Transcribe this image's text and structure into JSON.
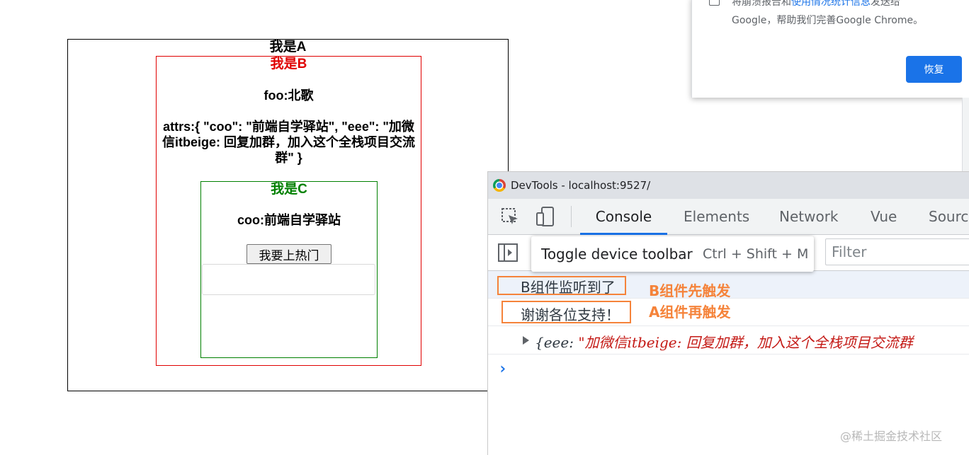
{
  "components": {
    "a": {
      "title": "我是A"
    },
    "b": {
      "title": "我是B",
      "foo": "foo:北歌",
      "attrs": "attrs:{ \"coo\": \"前端自学驿站\", \"eee\": \"加微信itbeige: 回复加群，加入这个全栈项目交流群\" }"
    },
    "c": {
      "title": "我是C",
      "coo": "coo:前端自学驿站",
      "button_label": "我要上热门",
      "input_value": ""
    }
  },
  "popup": {
    "line1_prefix": "将崩溃报告和",
    "line1_link": "使用情况统计信息",
    "line1_suffix": "发送给",
    "line2": "Google，帮助我们完善Google Chrome。",
    "button_label": "恢复"
  },
  "devtools": {
    "window_title": "DevTools - localhost:9527/",
    "tabs": [
      "Console",
      "Elements",
      "Network",
      "Vue",
      "Sourc"
    ],
    "active_tab": "Console",
    "tooltip_label": "Toggle device toolbar",
    "tooltip_shortcut": "Ctrl + Shift + M",
    "filter_placeholder": "Filter",
    "console": {
      "messages": [
        "B组件监听到了",
        "谢谢各位支持！"
      ],
      "object_key": "{eee: ",
      "object_value": "\"加微信itbeige: 回复加群，加入这个全栈项目交流群"
    },
    "prompt": "›"
  },
  "annotations": {
    "b_first": "B组件先触发",
    "a_second": "A组件再触发"
  },
  "watermark": "@稀土掘金技术社区",
  "colors": {
    "accent": "#1a73e8",
    "annotation": "#f5833a",
    "component_b": "#e00000",
    "component_c": "#008000"
  }
}
